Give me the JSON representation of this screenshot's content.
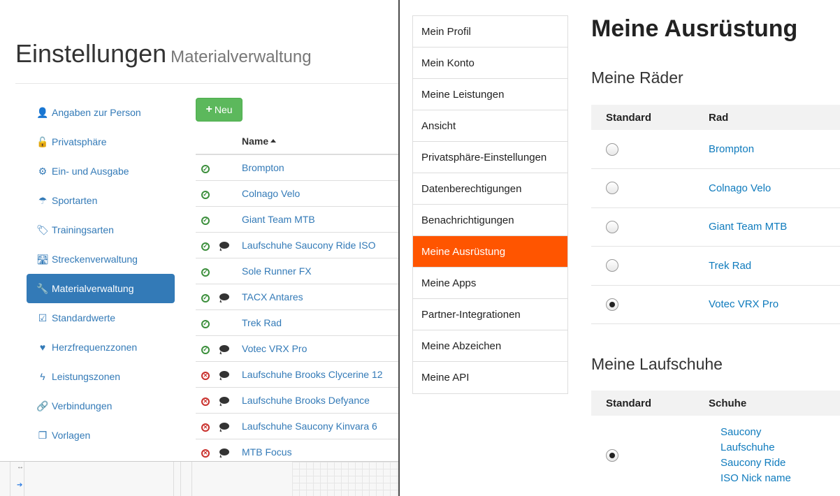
{
  "left": {
    "title": "Einstellungen",
    "subtitle": "Materialverwaltung",
    "nav": [
      {
        "label": "Angaben zur Person",
        "icon": "person-icon",
        "glyph": "👤"
      },
      {
        "label": "Privatsphäre",
        "icon": "unlock-icon",
        "glyph": "🔓"
      },
      {
        "label": "Ein- und Ausgabe",
        "icon": "gears-icon",
        "glyph": "⚙"
      },
      {
        "label": "Sportarten",
        "icon": "parachute-icon",
        "glyph": "☂"
      },
      {
        "label": "Trainingsarten",
        "icon": "tag-icon",
        "glyph": "🏷"
      },
      {
        "label": "Streckenverwaltung",
        "icon": "road-icon",
        "glyph": "🛣"
      },
      {
        "label": "Materialverwaltung",
        "icon": "wrench-icon",
        "glyph": "🔧",
        "active": true
      },
      {
        "label": "Standardwerte",
        "icon": "checkbox-icon",
        "glyph": "☑"
      },
      {
        "label": "Herzfrequenzzonen",
        "icon": "heart-icon",
        "glyph": "♥"
      },
      {
        "label": "Leistungszonen",
        "icon": "flash-icon",
        "glyph": "ϟ"
      },
      {
        "label": "Verbindungen",
        "icon": "link-icon",
        "glyph": "🔗"
      },
      {
        "label": "Vorlagen",
        "icon": "copy-icon",
        "glyph": "❐"
      }
    ],
    "new_button": "Neu",
    "table": {
      "header_name": "Name",
      "rows": [
        {
          "status": "ok",
          "comment": false,
          "name": "Brompton"
        },
        {
          "status": "ok",
          "comment": false,
          "name": "Colnago Velo"
        },
        {
          "status": "ok",
          "comment": false,
          "name": "Giant Team MTB"
        },
        {
          "status": "ok",
          "comment": true,
          "name": "Laufschuhe Saucony Ride ISO"
        },
        {
          "status": "ok",
          "comment": false,
          "name": "Sole Runner FX"
        },
        {
          "status": "ok",
          "comment": true,
          "name": "TACX Antares"
        },
        {
          "status": "ok",
          "comment": false,
          "name": "Trek Rad"
        },
        {
          "status": "ok",
          "comment": true,
          "name": "Votec VRX Pro"
        },
        {
          "status": "bad",
          "comment": true,
          "name": "Laufschuhe Brooks Clycerine 12"
        },
        {
          "status": "bad",
          "comment": true,
          "name": "Laufschuhe Brooks Defyance"
        },
        {
          "status": "bad",
          "comment": true,
          "name": "Laufschuhe Saucony Kinvara 6"
        },
        {
          "status": "bad",
          "comment": true,
          "name": "MTB Focus"
        }
      ]
    },
    "colors": {
      "link": "#337ab7",
      "active_nav": "#337ab7",
      "new_button": "#5cb85c",
      "ok": "#3c8f3c",
      "bad": "#c9302c"
    }
  },
  "right": {
    "menu": [
      {
        "label": "Mein Profil"
      },
      {
        "label": "Mein Konto"
      },
      {
        "label": "Meine Leistungen"
      },
      {
        "label": "Ansicht"
      },
      {
        "label": "Privatsphäre-Einstellungen"
      },
      {
        "label": "Datenberechtigungen"
      },
      {
        "label": "Benachrichtigungen"
      },
      {
        "label": "Meine Ausrüstung",
        "active": true
      },
      {
        "label": "Meine Apps"
      },
      {
        "label": "Partner-Integrationen"
      },
      {
        "label": "Meine Abzeichen"
      },
      {
        "label": "Meine API"
      }
    ],
    "title": "Meine Ausrüstung",
    "bikes": {
      "title": "Meine Räder",
      "col_default": "Standard",
      "col_name": "Rad",
      "rows": [
        {
          "name": "Brompton",
          "selected": false
        },
        {
          "name": "Colnago Velo",
          "selected": false
        },
        {
          "name": "Giant Team MTB",
          "selected": false
        },
        {
          "name": "Trek Rad",
          "selected": false
        },
        {
          "name": "Votec VRX Pro",
          "selected": true
        }
      ]
    },
    "shoes": {
      "title": "Meine Laufschuhe",
      "col_default": "Standard",
      "col_name": "Schuhe",
      "rows": [
        {
          "lines": [
            "Saucony",
            "Laufschuhe",
            "Saucony Ride",
            "ISO Nick name"
          ],
          "selected": true
        }
      ]
    },
    "colors": {
      "accent": "#ff5500",
      "link": "#0f7bbd"
    }
  }
}
